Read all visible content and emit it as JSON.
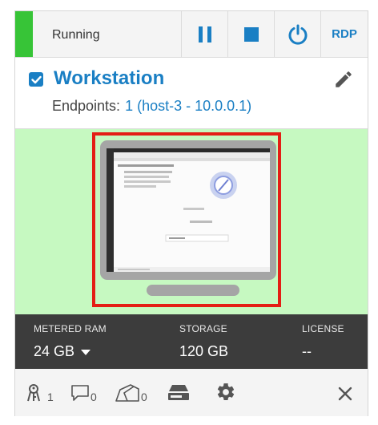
{
  "topbar": {
    "status": "Running",
    "status_color": "#37c437",
    "buttons": [
      {
        "name": "pause",
        "icon": "pause-icon"
      },
      {
        "name": "stop",
        "icon": "stop-icon"
      },
      {
        "name": "power",
        "icon": "power-icon"
      },
      {
        "name": "rdp",
        "label": "RDP"
      }
    ]
  },
  "vm": {
    "name": "Workstation",
    "selected": true,
    "endpoints_label": "Endpoints:",
    "endpoints_value": "1 (host-3 - 10.0.0.1)"
  },
  "preview": {
    "screen_heading": "Welcome to Windows Server",
    "screen_text": "Server Manager"
  },
  "stats": [
    {
      "label": "METERED RAM",
      "value": "24 GB",
      "dropdown": true
    },
    {
      "label": "STORAGE",
      "value": "120 GB"
    },
    {
      "label": "LICENSE",
      "value": "--"
    }
  ],
  "footer": {
    "users_count": "1",
    "comments_count": "0",
    "tags_count": "0"
  },
  "colors": {
    "accent": "#1a7fc4",
    "preview_bg": "#c6f9c1",
    "highlight_border": "#e41e15",
    "stats_bg": "#3c3c3c"
  }
}
